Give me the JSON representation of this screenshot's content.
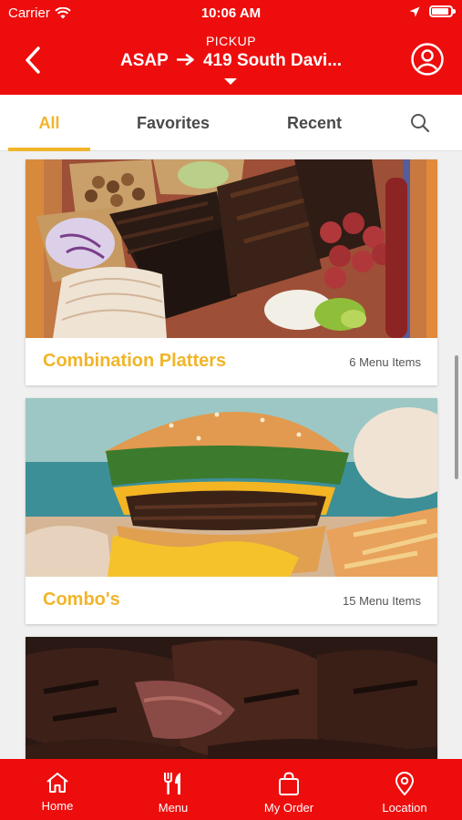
{
  "status_bar": {
    "carrier": "Carrier",
    "time": "10:06 AM"
  },
  "header": {
    "pickup_label": "PICKUP",
    "when": "ASAP",
    "destination": "419 South Davi..."
  },
  "tabs": [
    {
      "label": "All",
      "active": true
    },
    {
      "label": "Favorites",
      "active": false
    },
    {
      "label": "Recent",
      "active": false
    }
  ],
  "categories": [
    {
      "title": "Combination Platters",
      "count": "6 Menu Items",
      "image": "bbq-platter-photo"
    },
    {
      "title": "Combo's",
      "count": "15 Menu Items",
      "image": "burger-photo"
    },
    {
      "title": "",
      "count": "",
      "image": "smoked-meat-photo"
    }
  ],
  "bottom_nav": [
    {
      "label": "Home",
      "icon": "home-icon"
    },
    {
      "label": "Menu",
      "icon": "fork-knife-icon"
    },
    {
      "label": "My Order",
      "icon": "shopping-bag-icon"
    },
    {
      "label": "Location",
      "icon": "map-pin-icon"
    }
  ],
  "colors": {
    "brand_red": "#ee0d0d",
    "accent_gold": "#f1b529"
  }
}
